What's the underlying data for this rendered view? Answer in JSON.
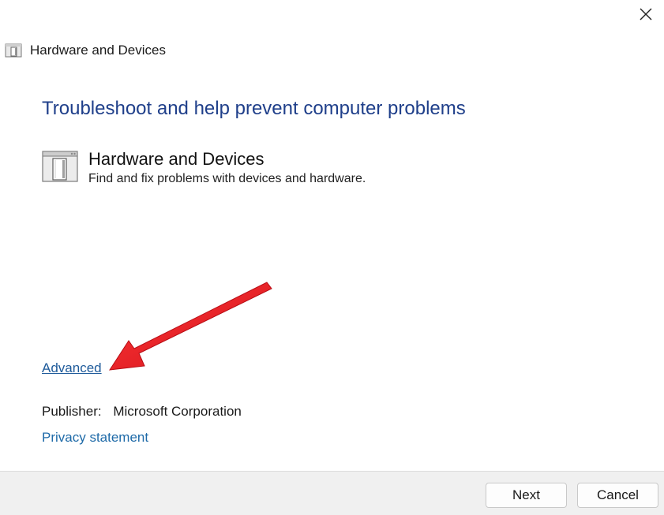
{
  "window": {
    "title": "Hardware and Devices",
    "close_icon": "close-icon"
  },
  "main": {
    "headline": "Troubleshoot and help prevent computer problems",
    "troubleshooter": {
      "icon": "hardware-device-icon",
      "title": "Hardware and Devices",
      "description": "Find and fix problems with devices and hardware."
    },
    "advanced_link": "Advanced",
    "publisher_label": "Publisher:",
    "publisher_value": "Microsoft Corporation",
    "privacy_link": "Privacy statement"
  },
  "footer": {
    "next_label": "Next",
    "cancel_label": "Cancel"
  },
  "annotation": {
    "arrow_color": "#e8141c"
  }
}
